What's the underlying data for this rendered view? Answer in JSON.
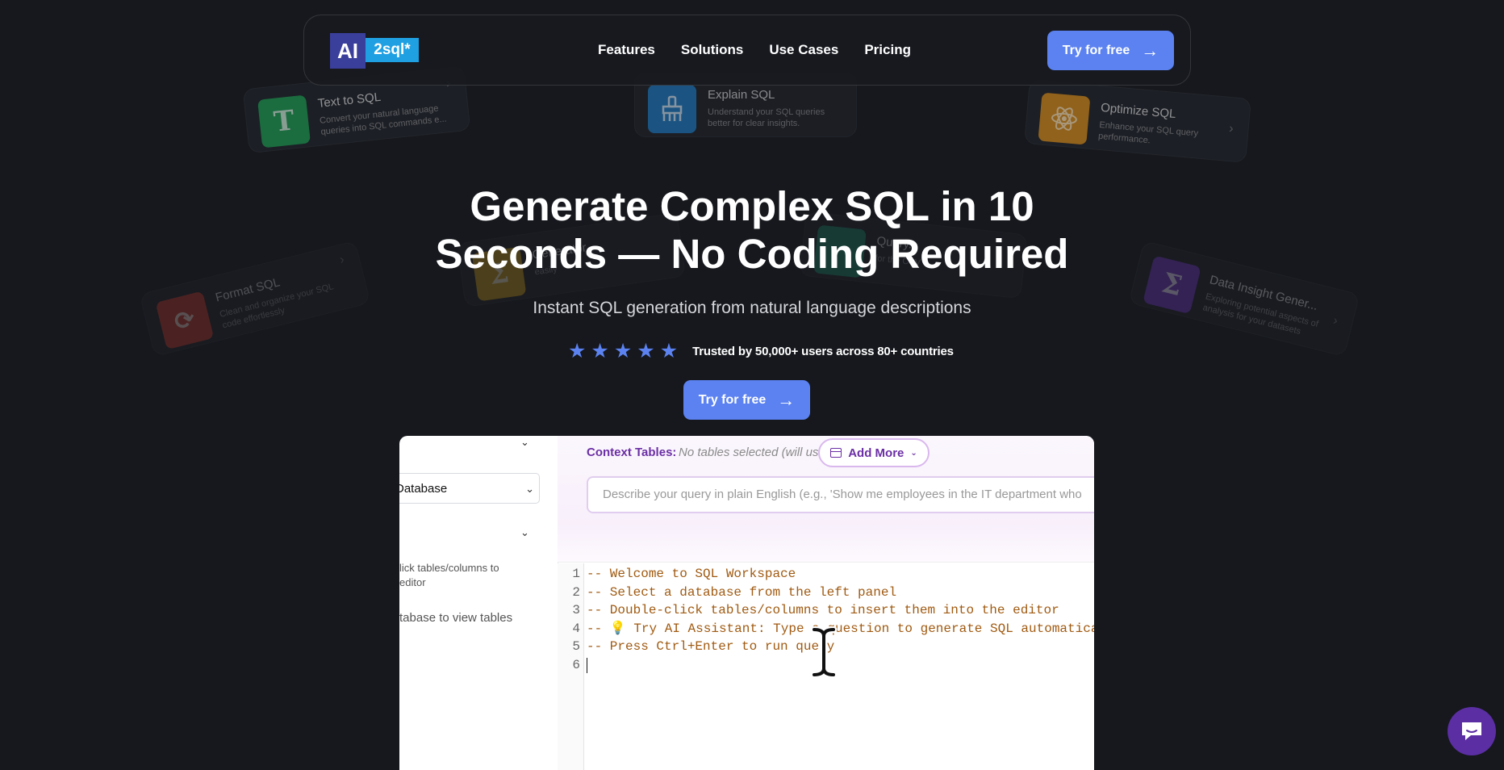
{
  "nav": {
    "logo_ai": "AI",
    "logo_sql": "2sql*",
    "items": [
      "Features",
      "Solutions",
      "Use Cases",
      "Pricing"
    ],
    "cta": "Try for free"
  },
  "bg_cards": [
    {
      "title": "Text to SQL",
      "desc": "Convert your natural language queries into SQL commands e...",
      "glyph": "T"
    },
    {
      "title": "Explain SQL",
      "desc": "Understand your SQL queries better for clear insights.",
      "glyph": ""
    },
    {
      "title": "Optimize SQL",
      "desc": "Enhance your SQL query performance.",
      "glyph": ""
    },
    {
      "title": "Format SQL",
      "desc": "Clean and organize your SQL code effortlessly",
      "glyph": ""
    },
    {
      "title": "Data Insight Gener...",
      "desc": "Exploring potential aspects of analysis for your datasets",
      "glyph": "Σ"
    },
    {
      "title": "Generator",
      "desc": "easily",
      "glyph": "Σ"
    },
    {
      "title": "Query...",
      "desc": "for the CSV",
      "glyph": ""
    }
  ],
  "hero": {
    "title_line1": "Generate Complex SQL in 10",
    "title_line2": "Seconds — No Coding Required",
    "subtitle": "Instant SQL generation from natural language descriptions",
    "rating": 5,
    "trust_text": "Trusted by 50,000+ users across 80+ countries",
    "cta": "Try for free"
  },
  "workspace": {
    "left": {
      "db_select_value": "Database",
      "hint_line1": "lick tables/columns to",
      "hint_line2": "editor",
      "empty_text": "tabase to view tables"
    },
    "context": {
      "label": "Context Tables:",
      "none_text": "No tables selected (will use all)",
      "add_more": "Add More"
    },
    "query_placeholder": "Describe your query in plain English (e.g., 'Show me employees in the IT department who",
    "editor": {
      "line_numbers": [
        "1",
        "2",
        "3",
        "4",
        "5",
        "6"
      ],
      "lines": [
        "-- Welcome to SQL Workspace",
        "-- Select a database from the left panel",
        "-- Double-click tables/columns to insert them into the editor",
        "-- 💡 Try AI Assistant: Type a question to generate SQL automatically",
        "-- Press Ctrl+Enter to run query",
        ""
      ]
    }
  },
  "colors": {
    "background": "#16181d",
    "primary": "#5b82f0",
    "accent_purple": "#6b2fa5",
    "code_comment": "#a05a11",
    "chat": "#5b2ea3"
  }
}
